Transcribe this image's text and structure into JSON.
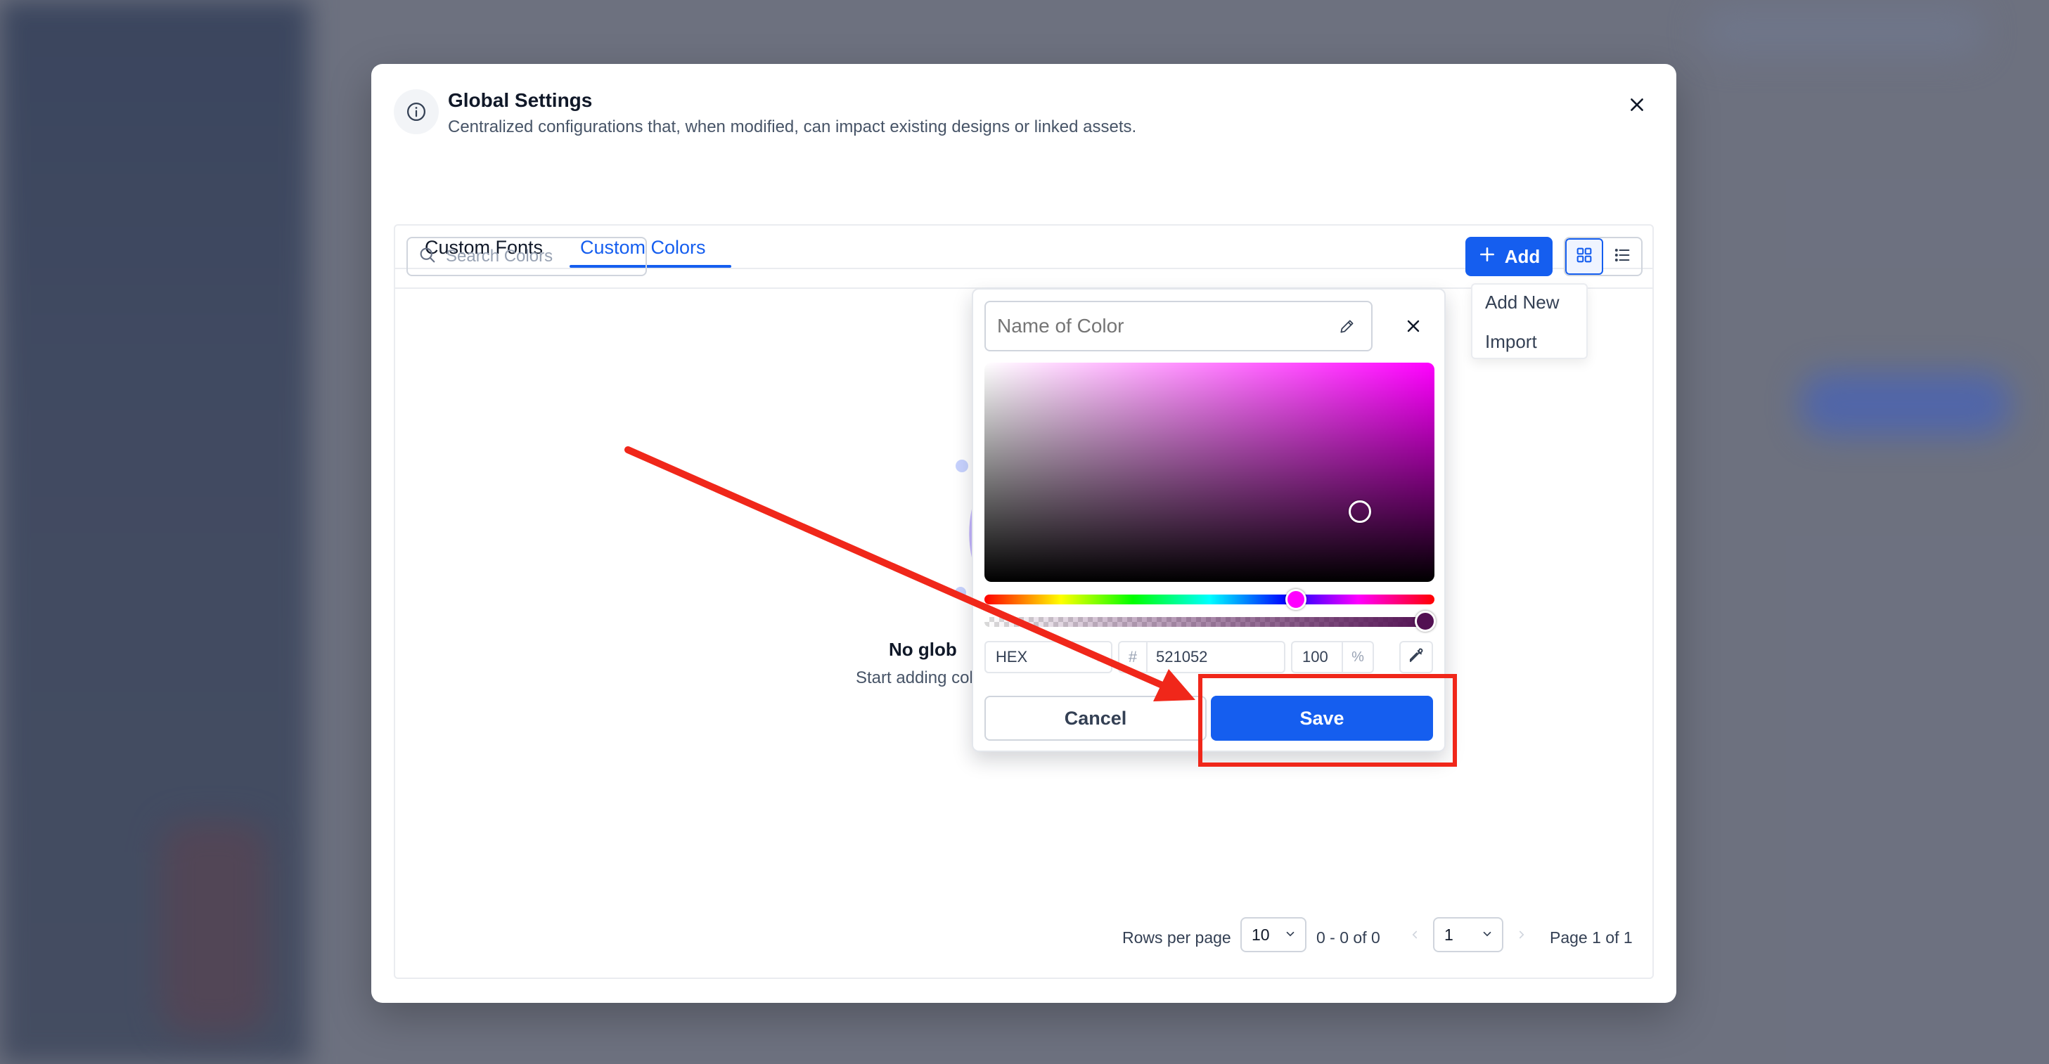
{
  "dialog": {
    "title": "Global Settings",
    "subtitle": "Centralized configurations that, when modified, can impact existing designs or linked assets."
  },
  "tabs": [
    {
      "label": "Custom Fonts",
      "active": false
    },
    {
      "label": "Custom Colors",
      "active": true
    }
  ],
  "toolbar": {
    "search_placeholder": "Search Colors",
    "add_label": "Add",
    "add_menu": [
      "Add New",
      "Import"
    ]
  },
  "empty_state": {
    "title": "No glob",
    "description": "Start adding colo"
  },
  "pagination": {
    "rows_per_page_label": "Rows per page",
    "rows_per_page_value": "10",
    "range_text": "0 - 0 of 0",
    "current_page": "1",
    "page_text": "Page 1 of 1"
  },
  "color_picker": {
    "name_placeholder": "Name of Color",
    "format": "HEX",
    "hash_symbol": "#",
    "hex_value": "521052",
    "alpha_value": "100",
    "alpha_unit": "%",
    "cancel_label": "Cancel",
    "save_label": "Save",
    "selected_color": "#521052",
    "hue_color": "#ff00ff"
  },
  "colors": {
    "accent": "#155eef",
    "annotation": "#f0271a"
  }
}
